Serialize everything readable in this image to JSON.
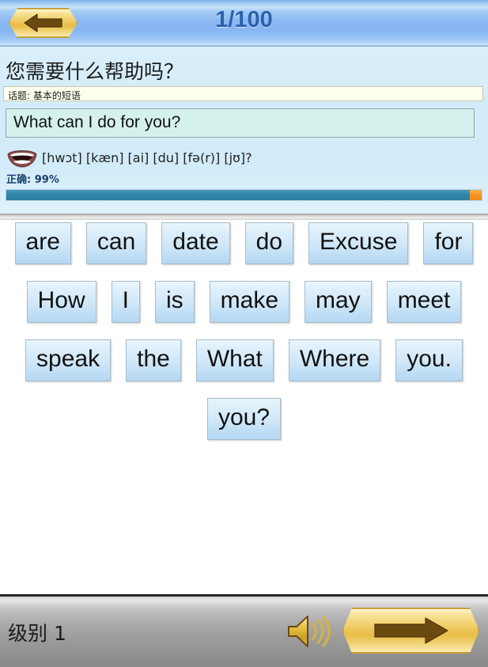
{
  "header": {
    "back_button_label": "back",
    "progress_counter": "1/100",
    "back_icon": "arrow-left-icon"
  },
  "lesson": {
    "question_zh": "您需要什么帮助吗？",
    "topic_line": "话题: 基本的短语",
    "answer_text": "What can I do for you?",
    "phonetic": "[hwɔt] [kæn] [ai] [du] [fə(r)] [jʊ]?",
    "pronounce_icon": "mouth-icon",
    "accuracy_label": "正确: 99%",
    "accuracy_percent": 99,
    "progress_fill_percent": 97.5,
    "progress_marker_percent": 2.5
  },
  "word_bank": {
    "rows": [
      [
        "are",
        "can",
        "date",
        "do",
        "Excuse",
        "for"
      ],
      [
        "How",
        "I",
        "is",
        "make",
        "may",
        "meet"
      ],
      [
        "speak",
        "the",
        "What",
        "Where",
        "you."
      ],
      [
        "you?"
      ]
    ]
  },
  "footer": {
    "level_label": "级别 1",
    "speaker_icon": "speaker-icon",
    "next_icon": "arrow-right-icon",
    "next_button_label": "next"
  },
  "colors": {
    "header_blue": "#86b6f2",
    "title_blue": "#2a62ad",
    "gold": "#ecc659",
    "gold_border": "#c9a233",
    "arrow_brown": "#6b4a10",
    "panel_blue": "#d4ecfa",
    "answer_mint": "#d5f1ee",
    "topic_cream": "#ffffee",
    "progress_teal": "#2f88a8",
    "progress_orange": "#f59120",
    "tile_blue": "#cfe7f8",
    "footer_grey": "#a9a9a9",
    "accuracy_navy": "#173f6e"
  }
}
